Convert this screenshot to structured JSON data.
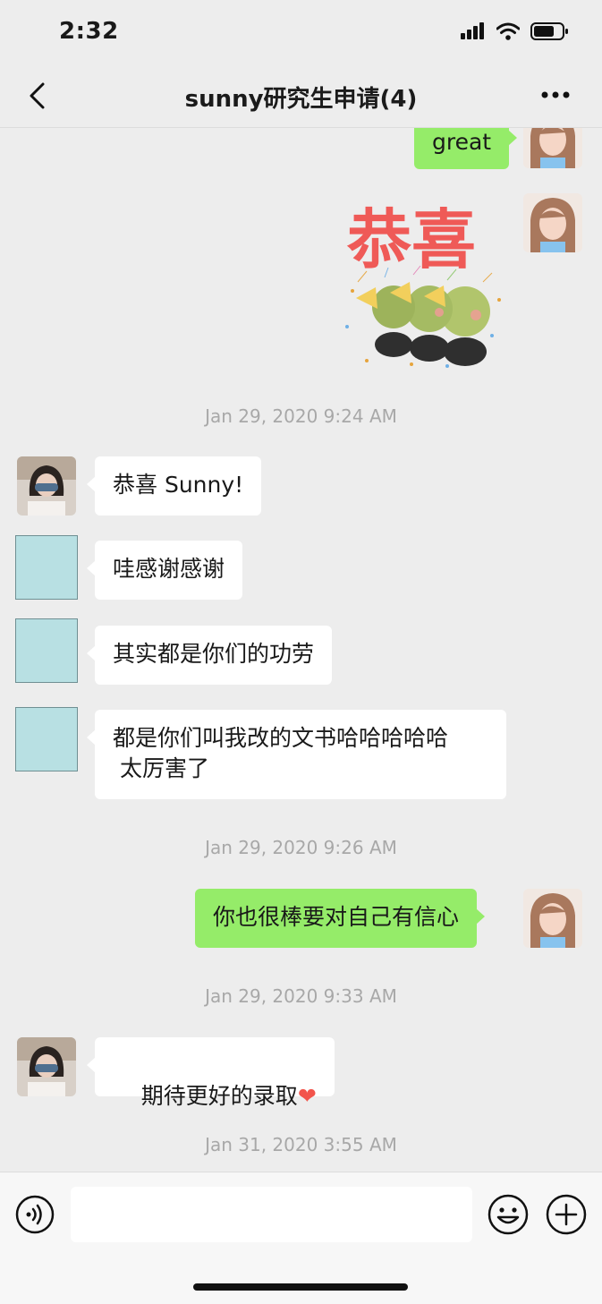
{
  "status": {
    "time": "2:32"
  },
  "nav": {
    "title": "sunny研究生申请(4)"
  },
  "messages": {
    "m1": "great",
    "sticker_text": "恭喜",
    "ts1": "Jan 29, 2020 9:24 AM",
    "m2": "恭喜 Sunny!",
    "m3": "哇感谢感谢",
    "m4": "其实都是你们的功劳",
    "m5": "都是你们叫我改的文书哈哈哈哈哈\n 太厉害了",
    "ts2": "Jan 29, 2020 9:26 AM",
    "m6": "你也很棒要对自己有信心",
    "ts3": "Jan 29, 2020 9:33 AM",
    "m7": "期待更好的录取",
    "m7_emoji": "❤",
    "ts4": "Jan 31, 2020 3:55 AM"
  },
  "input": {
    "value": ""
  },
  "colors": {
    "outgoing_bubble": "#95ec69",
    "incoming_bubble": "#ffffff",
    "background": "#ededed"
  },
  "icons": [
    "signal-icon",
    "wifi-icon",
    "battery-icon",
    "back-icon",
    "more-icon",
    "voice-icon",
    "emoji-icon",
    "plus-icon"
  ]
}
